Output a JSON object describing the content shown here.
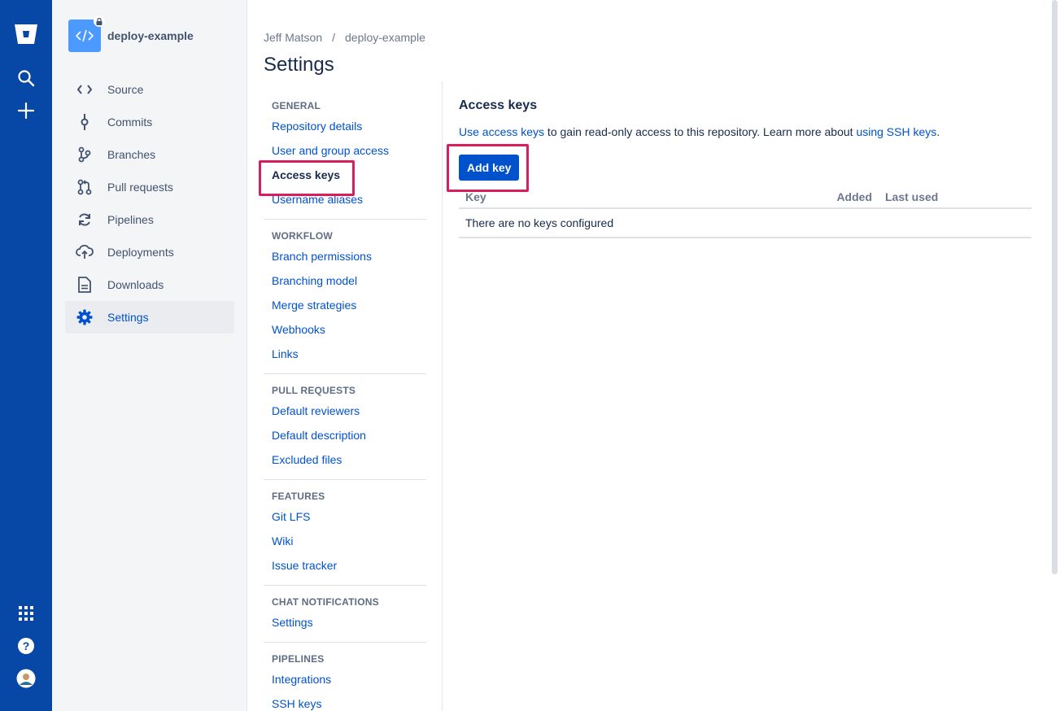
{
  "global_nav": {
    "logo_icon": "bitbucket-logo",
    "top_icons": [
      "search-icon",
      "create-icon"
    ],
    "bottom_icons": [
      "app-switcher-icon",
      "help-icon",
      "profile-avatar"
    ]
  },
  "repo": {
    "name": "deploy-example",
    "avatar_icon": "code-icon",
    "private_icon": "lock-icon"
  },
  "sidebar": {
    "items": [
      {
        "label": "Source",
        "icon": "source-icon"
      },
      {
        "label": "Commits",
        "icon": "commits-icon"
      },
      {
        "label": "Branches",
        "icon": "branches-icon"
      },
      {
        "label": "Pull requests",
        "icon": "pull-requests-icon"
      },
      {
        "label": "Pipelines",
        "icon": "pipelines-icon"
      },
      {
        "label": "Deployments",
        "icon": "deployments-icon"
      },
      {
        "label": "Downloads",
        "icon": "downloads-icon"
      },
      {
        "label": "Settings",
        "icon": "settings-gear-icon",
        "active": true
      }
    ]
  },
  "breadcrumb": {
    "owner": "Jeff Matson",
    "separator": "/",
    "repo": "deploy-example"
  },
  "page_title": "Settings",
  "settings_nav": {
    "general": {
      "heading": "GENERAL",
      "links": [
        "Repository details",
        "User and group access",
        "Access keys",
        "Username aliases"
      ]
    },
    "workflow": {
      "heading": "WORKFLOW",
      "links": [
        "Branch permissions",
        "Branching model",
        "Merge strategies",
        "Webhooks",
        "Links"
      ]
    },
    "pull_requests": {
      "heading": "PULL REQUESTS",
      "links": [
        "Default reviewers",
        "Default description",
        "Excluded files"
      ]
    },
    "features": {
      "heading": "FEATURES",
      "links": [
        "Git LFS",
        "Wiki",
        "Issue tracker"
      ]
    },
    "chat_notifications": {
      "heading": "CHAT NOTIFICATIONS",
      "links": [
        "Settings"
      ]
    },
    "pipelines": {
      "heading": "PIPELINES",
      "links": [
        "Integrations",
        "SSH keys"
      ]
    }
  },
  "content": {
    "title": "Access keys",
    "desc_link1": "Use access keys",
    "desc_middle": " to gain read-only access to this repository. Learn more about ",
    "desc_link2": "using SSH keys",
    "desc_end": ".",
    "add_key_label": "Add key",
    "table": {
      "columns": [
        "Key",
        "Added",
        "Last used"
      ],
      "empty_message": "There are no keys configured"
    }
  },
  "colors": {
    "global_nav": "#0747a6",
    "link": "#0052cc",
    "highlight": "#d91e5b",
    "primary_button": "#0052cc"
  }
}
